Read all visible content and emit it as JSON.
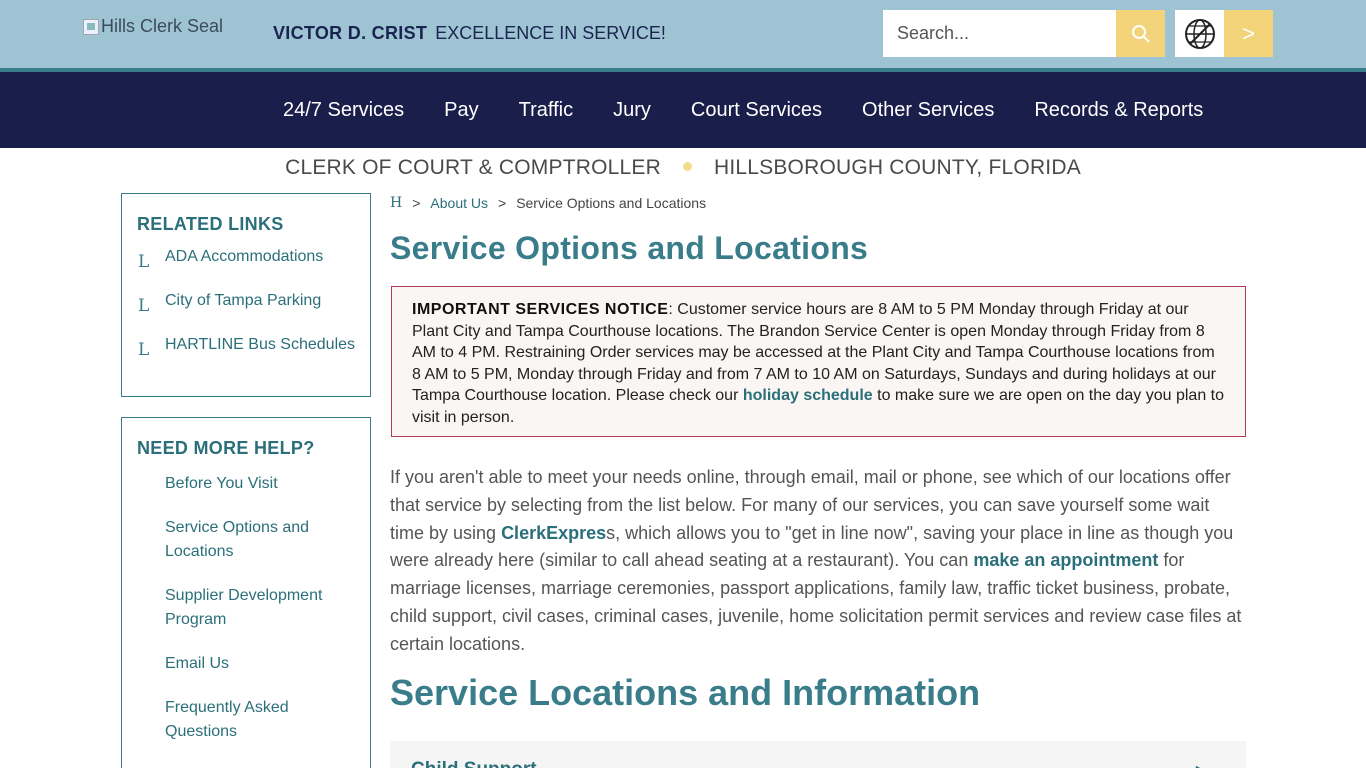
{
  "header": {
    "seal_alt": "Hills Clerk Seal",
    "name": "VICTOR D. CRIST",
    "slogan": "EXCELLENCE IN SERVICE!",
    "search_placeholder": "Search...",
    "go_label": ">"
  },
  "nav": {
    "items": [
      "24/7 Services",
      "Pay",
      "Traffic",
      "Jury",
      "Court Services",
      "Other Services",
      "Records & Reports"
    ]
  },
  "subheader": {
    "left": "CLERK OF COURT & COMPTROLLER",
    "right": "HILLSBOROUGH COUNTY, FLORIDA"
  },
  "sidebar": {
    "related_title": "RELATED LINKS",
    "related_icon": "L",
    "related": [
      "ADA Accommodations",
      "City of Tampa Parking",
      "HARTLINE Bus Schedules"
    ],
    "help_title": "NEED MORE HELP?",
    "help": [
      "Before You Visit",
      "Service Options and Locations",
      "Supplier Development Program",
      "Email Us",
      "Frequently Asked Questions"
    ]
  },
  "breadcrumb": {
    "home": "H",
    "sep": ">",
    "about": "About Us",
    "current": "Service Options and Locations"
  },
  "main": {
    "title": "Service Options and Locations",
    "notice_title": "IMPORTANT SERVICES NOTICE",
    "notice_text": ": Customer service hours are 8 AM to 5 PM Monday through Friday at our Plant City and Tampa Courthouse locations. The Brandon Service Center is open Monday through Friday from 8 AM to 4 PM.  Restraining Order services may be accessed at the Plant City and Tampa Courthouse locations from 8 AM to 5 PM, Monday through Friday and from 7 AM to 10 AM on Saturdays, Sundays and during holidays at our Tampa Courthouse location. Please check our ",
    "notice_link": "holiday schedule",
    "notice_end": " to make sure we are open on the day you plan to visit in person.",
    "intro_1": "If you aren't able to meet your needs online, through email, mail or phone, see which of our locations offer that service by selecting from the list below. For many of our services, you can save yourself some wait time by using ",
    "intro_link_1": "ClerkExpres",
    "intro_2": "s, which allows you to \"get in line now\", saving your place in line as though you were already here (similar to call ahead seating at a restaurant). You can ",
    "intro_link_2": "make an appointment",
    "intro_3": " for marriage licenses, marriage ceremonies, passport applications, family law, traffic ticket business, probate, child support, civil cases, criminal cases, juvenile, home solicitation permit services and review case files at certain locations.",
    "section_title": "Service Locations and Information",
    "accordion_first": "Child Support"
  },
  "colors": {
    "topbar": "#9ec3d3",
    "nav": "#1a1e4b",
    "accent": "#3a7d8a",
    "button": "#f4d47a",
    "notice_border": "#b03a5a"
  }
}
